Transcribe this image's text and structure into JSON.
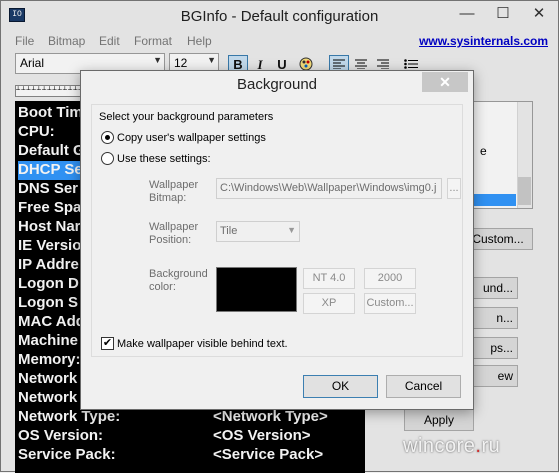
{
  "window": {
    "title": "BGInfo - Default configuration",
    "icon_text": "IO",
    "minimize": "—",
    "maximize": "☐",
    "close": "✕"
  },
  "menu": [
    "File",
    "Bitmap",
    "Edit",
    "Format",
    "Help"
  ],
  "site_link": "www.sysinternals.com",
  "toolbar": {
    "font": "Arial",
    "size": "12",
    "bold": "B",
    "italic": "I",
    "underline": "U"
  },
  "editor": {
    "lines": [
      {
        "label": "Boot Tim",
        "value": ""
      },
      {
        "label": "CPU:",
        "value": ""
      },
      {
        "label": "Default G",
        "value": ""
      },
      {
        "label": "DHCP Se",
        "value": "",
        "selected": true
      },
      {
        "label": "DNS Ser",
        "value": ""
      },
      {
        "label": "Free Spa",
        "value": ""
      },
      {
        "label": "Host Nar",
        "value": ""
      },
      {
        "label": "IE Versio",
        "value": ""
      },
      {
        "label": "IP Addre",
        "value": ""
      },
      {
        "label": "Logon D",
        "value": ""
      },
      {
        "label": "Logon S",
        "value": ""
      },
      {
        "label": "MAC Add",
        "value": ""
      },
      {
        "label": "Machine",
        "value": ""
      },
      {
        "label": "Memory:",
        "value": ""
      },
      {
        "label": "Network",
        "value": ""
      },
      {
        "label": "Network",
        "value": ""
      },
      {
        "label": "Network Type:",
        "value": "<Network Type>"
      },
      {
        "label": "OS Version:",
        "value": "<OS Version>"
      },
      {
        "label": "Service Pack:",
        "value": "<Service Pack>"
      }
    ]
  },
  "side_panel": {
    "list_fragment": "e",
    "buttons": [
      "Custom...",
      "und...",
      "n...",
      "ps...",
      "ew",
      "Apply"
    ]
  },
  "watermark": {
    "text": "wincore",
    "dot": ".",
    "tld": "ru"
  },
  "dialog": {
    "title": "Background",
    "close": "✕",
    "group_label": "Select your background parameters",
    "radio_copy": "Copy user's wallpaper settings",
    "radio_use": "Use these settings:",
    "wallpaper_bitmap_label": "Wallpaper\nBitmap:",
    "wallpaper_bitmap_value": "C:\\Windows\\Web\\Wallpaper\\Windows\\img0.j",
    "browse": "...",
    "wallpaper_position_label": "Wallpaper\nPosition:",
    "wallpaper_position_value": "Tile",
    "background_color_label": "Background\ncolor:",
    "background_color": "#000000",
    "color_buttons": [
      "NT 4.0",
      "2000",
      "XP",
      "Custom..."
    ],
    "make_visible": "Make wallpaper visible behind text.",
    "make_visible_checked": true,
    "ok": "OK",
    "cancel": "Cancel"
  }
}
